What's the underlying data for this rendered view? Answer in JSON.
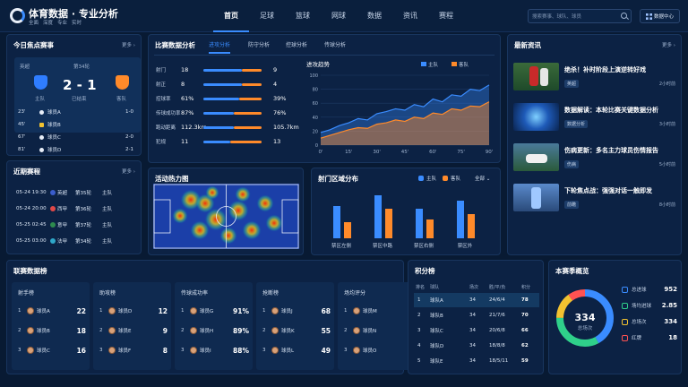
{
  "header": {
    "title": "体育数据 · 专业分析",
    "tags": [
      "全面",
      "深度",
      "专业",
      "实时"
    ],
    "nav": [
      "首页",
      "足球",
      "篮球",
      "网球",
      "数据",
      "资讯",
      "赛程"
    ],
    "active_nav": 0,
    "search_placeholder": "搜索赛事、球队、球员",
    "data_center_label": "数据中心"
  },
  "today": {
    "title": "今日焦点赛事",
    "more": "更多",
    "league": "英超",
    "round": "第34轮",
    "home_label": "主队",
    "away_label": "客队",
    "score": "2 - 1",
    "status": "已结束",
    "colors": {
      "home": "#2f7dff",
      "away": "#ff8a2a"
    },
    "events": [
      {
        "minute": "23'",
        "player": "球员A",
        "score": "1-0",
        "icon": "ball-icon"
      },
      {
        "minute": "45'",
        "player": "球员B",
        "score": "",
        "icon": "yellow-card-icon"
      },
      {
        "minute": "67'",
        "player": "球员C",
        "score": "2-0",
        "icon": "ball-icon"
      },
      {
        "minute": "81'",
        "player": "球员D",
        "score": "2-1",
        "icon": "ball-icon"
      }
    ]
  },
  "schedule": {
    "title": "近期赛程",
    "more": "更多",
    "rows": [
      {
        "time": "05-24 19:30",
        "league": "英超",
        "round": "第35轮",
        "team": "主队"
      },
      {
        "time": "05-24 20:00",
        "league": "西甲",
        "round": "第36轮",
        "team": "主队"
      },
      {
        "time": "05-25 02:45",
        "league": "意甲",
        "round": "第37轮",
        "team": "主队"
      },
      {
        "time": "05-25 03:00",
        "league": "法甲",
        "round": "第34轮",
        "team": "主队"
      }
    ]
  },
  "analysis": {
    "title": "比赛数据分析",
    "tabs": [
      "进攻分析",
      "防守分析",
      "控球分析",
      "传球分析"
    ],
    "active_tab": 0,
    "stats": [
      {
        "name": "射门",
        "home": "18",
        "away": "9",
        "home_frac": 0.66,
        "away_frac": 0.34
      },
      {
        "name": "射正",
        "home": "8",
        "away": "4",
        "home_frac": 0.66,
        "away_frac": 0.34
      },
      {
        "name": "控球率",
        "home": "61%",
        "away": "39%",
        "home_frac": 0.61,
        "away_frac": 0.39
      },
      {
        "name": "传球成功率",
        "home": "87%",
        "away": "76%",
        "home_frac": 0.53,
        "away_frac": 0.47
      },
      {
        "name": "跑动距离",
        "home": "112.3km",
        "away": "105.7km",
        "home_frac": 0.52,
        "away_frac": 0.48
      },
      {
        "name": "犯规",
        "home": "11",
        "away": "13",
        "home_frac": 0.46,
        "away_frac": 0.54
      }
    ]
  },
  "trend": {
    "title": "进攻趋势",
    "legend": [
      "主队",
      "客队"
    ],
    "y_ticks": [
      "100",
      "80",
      "60",
      "40",
      "20",
      "0"
    ],
    "x_ticks": [
      "0'",
      "15'",
      "30'",
      "45'",
      "60'",
      "75'",
      "90'"
    ],
    "chart_data": {
      "type": "area",
      "x": [
        0,
        5,
        10,
        15,
        20,
        25,
        30,
        35,
        40,
        45,
        50,
        55,
        60,
        65,
        70,
        75,
        80,
        85,
        90
      ],
      "ylim": [
        0,
        100
      ],
      "series": [
        {
          "name": "主队",
          "values": [
            18,
            22,
            28,
            32,
            38,
            36,
            45,
            48,
            52,
            50,
            58,
            55,
            66,
            62,
            72,
            70,
            80,
            78,
            86
          ]
        },
        {
          "name": "客队",
          "values": [
            10,
            14,
            18,
            22,
            25,
            24,
            30,
            32,
            36,
            34,
            40,
            38,
            46,
            44,
            52,
            50,
            56,
            55,
            62
          ]
        }
      ]
    }
  },
  "heatmap": {
    "title": "活动热力图"
  },
  "shots": {
    "title": "射门区域分布",
    "legend": [
      "主队",
      "客队"
    ],
    "filter": "全部",
    "chart_data": {
      "type": "bar",
      "categories": [
        "禁区左侧",
        "禁区中路",
        "禁区右侧",
        "禁区外"
      ],
      "series": [
        {
          "name": "主队",
          "values": [
            12,
            16,
            11,
            14
          ]
        },
        {
          "name": "客队",
          "values": [
            6,
            11,
            7,
            9
          ]
        }
      ]
    }
  },
  "news": {
    "title": "最新资讯",
    "more": "更多",
    "items": [
      {
        "title": "绝杀！补时阶段上演逆转好戏",
        "tag": "英超",
        "time": "2小时前"
      },
      {
        "title": "数据解读：本轮比赛关键数据分析",
        "tag": "数据分析",
        "time": "3小时前"
      },
      {
        "title": "伤病更新：多名主力球员伤情报告",
        "tag": "伤病",
        "time": "5小时前"
      },
      {
        "title": "下轮焦点战：强强对话一触即发",
        "tag": "前瞻",
        "time": "8小时前"
      }
    ]
  },
  "leaders": {
    "title": "联赛数据榜",
    "boards": [
      {
        "title": "射手榜",
        "rows": [
          {
            "rank": "1",
            "name": "球员A",
            "value": "22"
          },
          {
            "rank": "2",
            "name": "球员B",
            "value": "18"
          },
          {
            "rank": "3",
            "name": "球员C",
            "value": "16"
          }
        ]
      },
      {
        "title": "助攻榜",
        "rows": [
          {
            "rank": "1",
            "name": "球员D",
            "value": "12"
          },
          {
            "rank": "2",
            "name": "球员E",
            "value": "9"
          },
          {
            "rank": "3",
            "name": "球员F",
            "value": "8"
          }
        ]
      },
      {
        "title": "传球成功率",
        "rows": [
          {
            "rank": "1",
            "name": "球员G",
            "value": "91%"
          },
          {
            "rank": "2",
            "name": "球员H",
            "value": "89%"
          },
          {
            "rank": "3",
            "name": "球员I",
            "value": "88%"
          }
        ]
      },
      {
        "title": "抢断榜",
        "rows": [
          {
            "rank": "1",
            "name": "球员J",
            "value": "68"
          },
          {
            "rank": "2",
            "name": "球员K",
            "value": "55"
          },
          {
            "rank": "3",
            "name": "球员L",
            "value": "49"
          }
        ]
      },
      {
        "title": "场均评分",
        "rows": [
          {
            "rank": "1",
            "name": "球员M",
            "value": ""
          },
          {
            "rank": "2",
            "name": "球员N",
            "value": ""
          },
          {
            "rank": "3",
            "name": "球员O",
            "value": ""
          }
        ]
      }
    ]
  },
  "standings": {
    "title": "积分榜",
    "headers": [
      "排名",
      "球队",
      "场次",
      "胜/平/负",
      "积分"
    ],
    "rows": [
      {
        "rank": "1",
        "team": "球队A",
        "played": "34",
        "record": "24/6/4",
        "points": "78"
      },
      {
        "rank": "2",
        "team": "球队B",
        "played": "34",
        "record": "21/7/6",
        "points": "70"
      },
      {
        "rank": "3",
        "team": "球队C",
        "played": "34",
        "record": "20/6/8",
        "points": "66"
      },
      {
        "rank": "4",
        "team": "球队D",
        "played": "34",
        "record": "18/8/8",
        "points": "62"
      },
      {
        "rank": "5",
        "team": "球队E",
        "played": "34",
        "record": "18/5/11",
        "points": "59"
      }
    ]
  },
  "season": {
    "title": "本赛季概览",
    "total": "334",
    "total_label": "总场次",
    "rows": [
      {
        "label": "总进球",
        "value": "952",
        "color": "#3a8cff"
      },
      {
        "label": "场均进球",
        "value": "2.85",
        "color": "#2fd08a"
      },
      {
        "label": "总场次",
        "value": "334",
        "color": "#f2c230"
      },
      {
        "label": "红牌",
        "value": "18",
        "color": "#ff5252"
      }
    ],
    "donut": {
      "segments": [
        0.42,
        0.33,
        0.15,
        0.1
      ]
    }
  }
}
